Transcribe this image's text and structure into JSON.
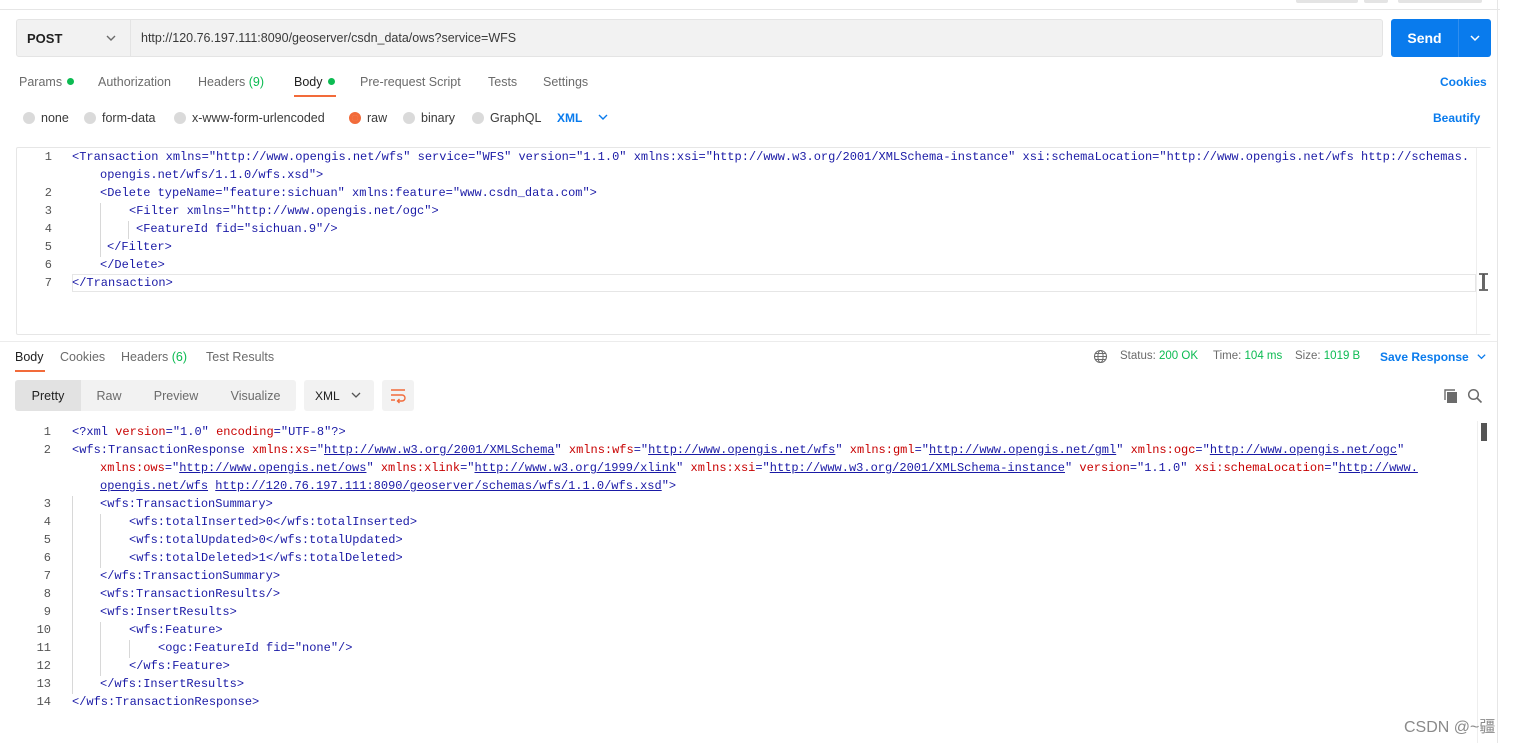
{
  "request": {
    "method": "POST",
    "url": "http://120.76.197.111:8090/geoserver/csdn_data/ows?service=WFS",
    "send_label": "Send"
  },
  "request_tabs": {
    "params": "Params",
    "authorization": "Authorization",
    "headers": "Headers",
    "headers_count": "(9)",
    "body": "Body",
    "pre_request": "Pre-request Script",
    "tests": "Tests",
    "settings": "Settings",
    "cookies": "Cookies",
    "active": "Body"
  },
  "body_types": {
    "none": "none",
    "form_data": "form-data",
    "urlencoded": "x-www-form-urlencoded",
    "raw": "raw",
    "binary": "binary",
    "graphql": "GraphQL",
    "selected": "raw",
    "language": "XML",
    "beautify": "Beautify"
  },
  "request_body": {
    "line_numbers": [
      "1",
      "2",
      "3",
      "4",
      "5",
      "6",
      "7"
    ],
    "lines": [
      "<Transaction xmlns=\"http://www.opengis.net/wfs\" service=\"WFS\" version=\"1.1.0\" xmlns:xsi=\"http://www.w3.org/2001/XMLSchema-instance\" xsi:schemaLocation=\"http://www.opengis.net/wfs http://schemas.",
      "opengis.net/wfs/1.1.0/wfs.xsd\">",
      "<Delete typeName=\"feature:sichuan\" xmlns:feature=\"www.csdn_data.com\">",
      "<Filter xmlns=\"http://www.opengis.net/ogc\">",
      "<FeatureId fid=\"sichuan.9\"/>",
      "</Filter>",
      "</Delete>",
      "</Transaction>"
    ]
  },
  "response_tabs": {
    "body": "Body",
    "cookies": "Cookies",
    "headers": "Headers",
    "headers_count": "(6)",
    "test_results": "Test Results",
    "active": "Body"
  },
  "response_meta": {
    "status_label": "Status:",
    "status_value": "200 OK",
    "time_label": "Time:",
    "time_value": "104 ms",
    "size_label": "Size:",
    "size_value": "1019 B",
    "save_response": "Save Response"
  },
  "response_view": {
    "pretty": "Pretty",
    "raw": "Raw",
    "preview": "Preview",
    "visualize": "Visualize",
    "format": "XML",
    "active": "Pretty"
  },
  "response_body": {
    "line_numbers": [
      "1",
      "2",
      "3",
      "4",
      "5",
      "6",
      "7",
      "8",
      "9",
      "10",
      "11",
      "12",
      "13",
      "14"
    ],
    "l1": {
      "open": "<?xml ",
      "a1": "version",
      "v1": "\"1.0\"",
      "a2": "encoding",
      "v2": "\"UTF-8\"",
      "close": "?>"
    },
    "l2": {
      "tag": "<wfs:TransactionResponse ",
      "xs_attr": "xmlns:xs",
      "xs_url": "http://www.w3.org/2001/XMLSchema",
      "wfs_attr": "xmlns:wfs",
      "wfs_url": "http://www.opengis.net/wfs",
      "gml_attr": "xmlns:gml",
      "gml_url": "http://www.opengis.net/gml",
      "ogc_attr": "xmlns:ogc",
      "ogc_url": "http://www.opengis.net/ogc",
      "ows_attr": "xmlns:ows",
      "ows_url": "http://www.opengis.net/ows",
      "xlink_attr": "xmlns:xlink",
      "xlink_url": "http://www.w3.org/1999/xlink",
      "xsi_attr": "xmlns:xsi",
      "xsi_url": "http://www.w3.org/2001/XMLSchema-instance",
      "version_attr": "version",
      "version_val": "\"1.1.0\"",
      "schema_attr": "xsi:schemaLocation",
      "schema_url_a": "http://www.",
      "schema_url_b": "opengis.net/wfs",
      "schema_url_c": "http://120.76.197.111:8090/geoserver/schemas/wfs/1.1.0/wfs.xsd"
    },
    "lines_rest": [
      "<wfs:TransactionSummary>",
      "<wfs:totalInserted>0</wfs:totalInserted>",
      "<wfs:totalUpdated>0</wfs:totalUpdated>",
      "<wfs:totalDeleted>1</wfs:totalDeleted>",
      "</wfs:TransactionSummary>",
      "<wfs:TransactionResults/>",
      "<wfs:InsertResults>",
      "<wfs:Feature>",
      "<ogc:FeatureId fid=\"none\"/>",
      "</wfs:Feature>",
      "</wfs:InsertResults>",
      "</wfs:TransactionResponse>"
    ]
  },
  "icons": {
    "globe": "globe-icon",
    "copy": "copy-icon",
    "search": "search-icon",
    "wrap": "wrap-lines-icon",
    "chevron": "chevron-down-icon"
  },
  "colors": {
    "accent": "#097bed",
    "active_tab": "#f26b3a",
    "success": "#0cbb52",
    "tag": "#1a1aa6",
    "attr": "#c80000"
  },
  "watermark": "CSDN @~疆"
}
